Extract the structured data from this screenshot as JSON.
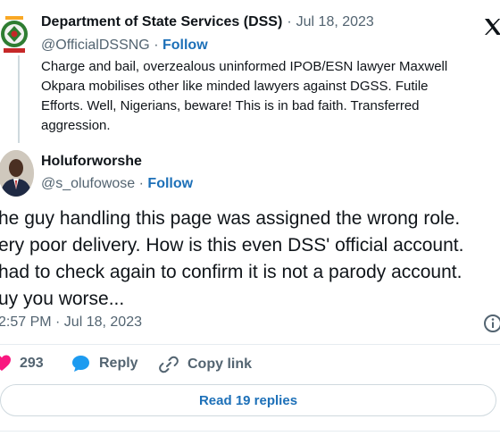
{
  "tweet1": {
    "author": "Department of State Services (DSS)",
    "date": "Jul 18, 2023",
    "handle": "@OfficialDSSNG",
    "follow_label": "Follow",
    "lines": [
      "Charge and bail, overzealous uninformed IPOB/ESN lawyer Maxwell",
      "Okpara mobilises other like minded lawyers against DGSS. Futile",
      "Efforts. Well, Nigerians, beware! This is in bad faith. Transferred",
      "aggression."
    ]
  },
  "tweet2": {
    "author": "Holuforworshe",
    "handle": "@s_olufowose",
    "follow_label": "Follow",
    "lines": [
      "he guy handling this page was assigned the wrong role.",
      "ery poor delivery. How is this even DSS' official account.",
      "had to check again to confirm it is not a parody account.",
      "uy you worse..."
    ],
    "timestamp": "2:57 PM · Jul 18, 2023"
  },
  "actions": {
    "like_count": "293",
    "reply_label": "Reply",
    "copy_link_label": "Copy link"
  },
  "read_replies_label": "Read 19 replies",
  "colors": {
    "accent": "#1d70b8",
    "like": "#f91880",
    "muted": "#536471"
  },
  "icons": [
    "dss-logo-icon",
    "x-logo-icon",
    "info-icon",
    "heart-icon",
    "reply-bubble-icon",
    "link-icon"
  ]
}
